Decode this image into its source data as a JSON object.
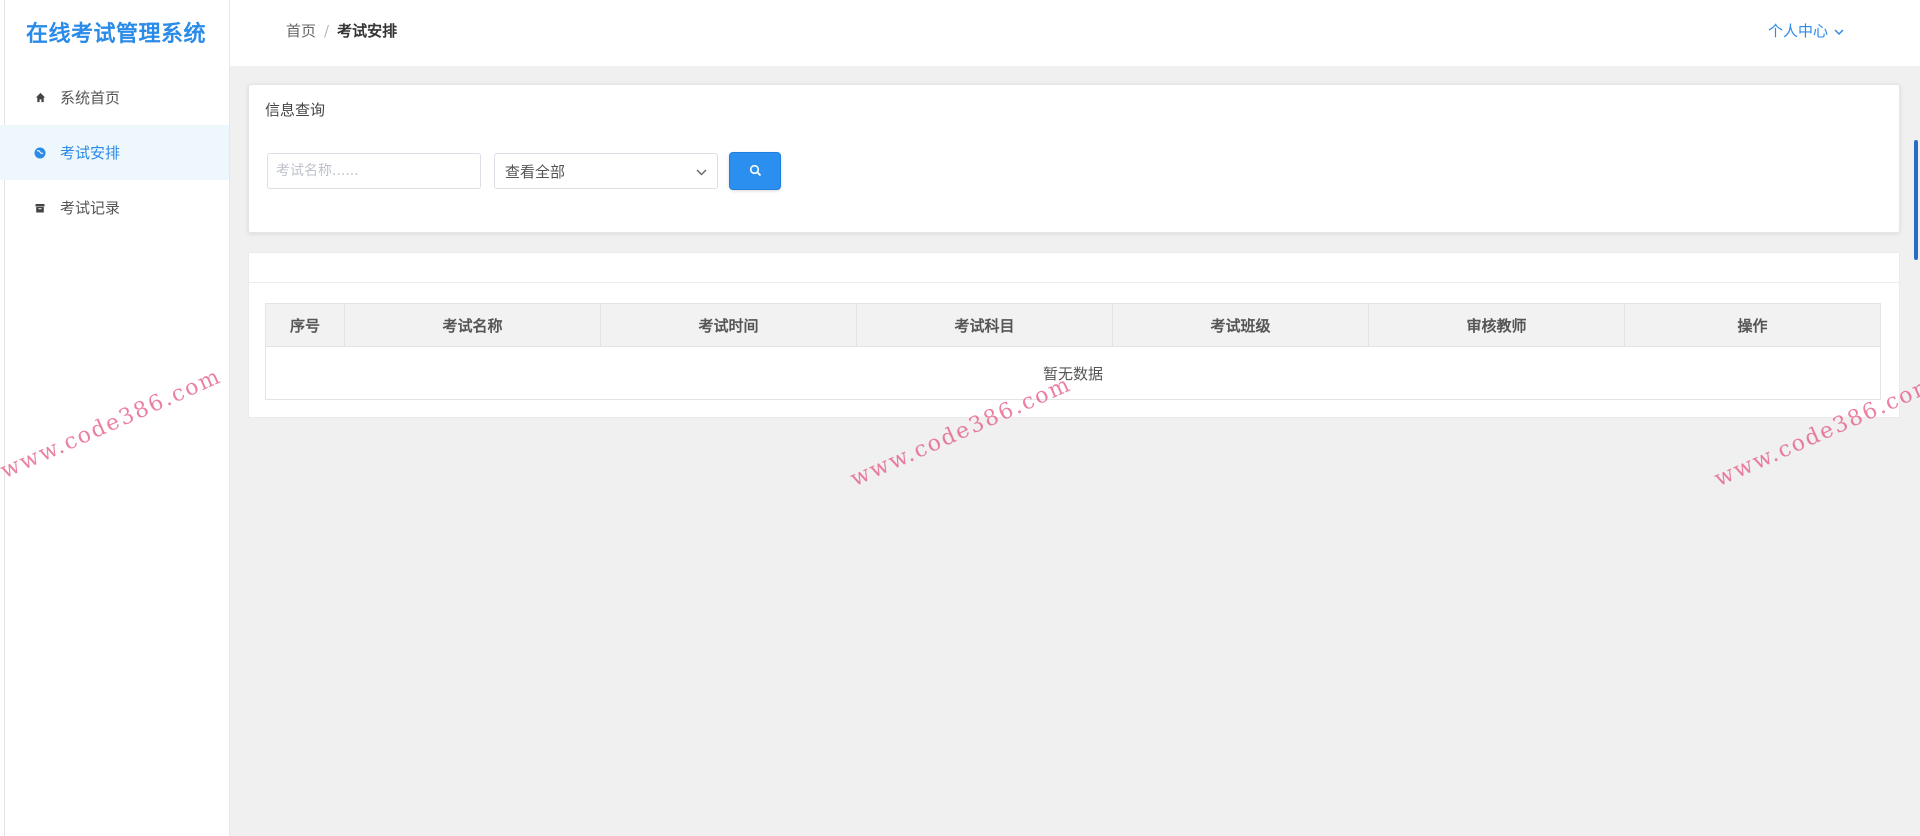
{
  "app": {
    "title": "在线考试管理系统"
  },
  "sidebar": {
    "items": [
      {
        "label": "系统首页",
        "icon": "home-icon",
        "active": false
      },
      {
        "label": "考试安排",
        "icon": "globe-icon",
        "active": true
      },
      {
        "label": "考试记录",
        "icon": "archive-icon",
        "active": false
      }
    ]
  },
  "header": {
    "breadcrumb": {
      "home": "首页",
      "separator": "/",
      "current": "考试安排"
    },
    "user_menu": "个人中心"
  },
  "search": {
    "title": "信息查询",
    "placeholder": "考试名称......",
    "select_value": "查看全部"
  },
  "table": {
    "columns": [
      "序号",
      "考试名称",
      "考试时间",
      "考试科目",
      "考试班级",
      "审核教师",
      "操作"
    ],
    "empty_text": "暂无数据"
  },
  "watermark": {
    "text": "www.code386.com"
  },
  "colors": {
    "accent": "#2b8be8",
    "button": "#2b8ff0",
    "active_bg": "#eef7fc",
    "watermark": "#e23c6e"
  }
}
